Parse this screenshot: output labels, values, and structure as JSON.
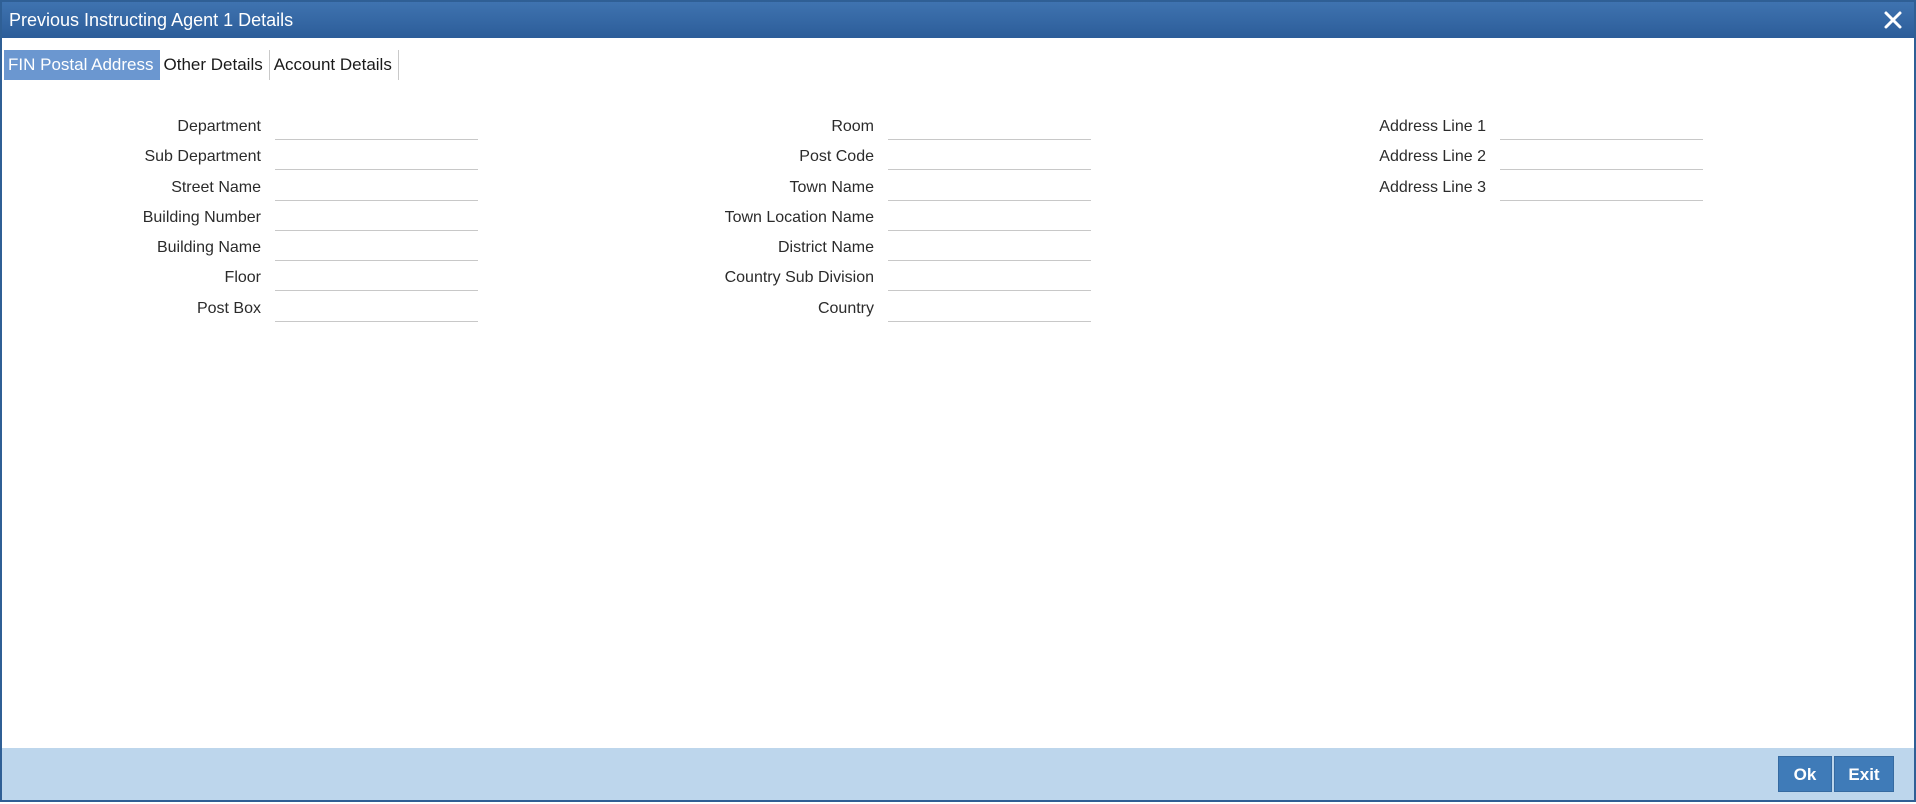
{
  "window": {
    "title": "Previous Instructing Agent 1 Details",
    "close_icon": "close-icon"
  },
  "tabs": [
    {
      "label": "FIN Postal Address",
      "active": true
    },
    {
      "label": "Other Details",
      "active": false
    },
    {
      "label": "Account Details",
      "active": false
    }
  ],
  "form": {
    "column1": [
      {
        "label": "Department",
        "value": ""
      },
      {
        "label": "Sub Department",
        "value": ""
      },
      {
        "label": "Street Name",
        "value": ""
      },
      {
        "label": "Building Number",
        "value": ""
      },
      {
        "label": "Building Name",
        "value": ""
      },
      {
        "label": "Floor",
        "value": ""
      },
      {
        "label": "Post Box",
        "value": ""
      }
    ],
    "column2": [
      {
        "label": "Room",
        "value": ""
      },
      {
        "label": "Post Code",
        "value": ""
      },
      {
        "label": "Town Name",
        "value": ""
      },
      {
        "label": "Town Location Name",
        "value": ""
      },
      {
        "label": "District Name",
        "value": ""
      },
      {
        "label": "Country Sub Division",
        "value": ""
      },
      {
        "label": "Country",
        "value": ""
      }
    ],
    "column3": [
      {
        "label": "Address Line 1",
        "value": ""
      },
      {
        "label": "Address Line 2",
        "value": ""
      },
      {
        "label": "Address Line 3",
        "value": ""
      }
    ]
  },
  "footer": {
    "ok_label": "Ok",
    "exit_label": "Exit"
  },
  "colors": {
    "titlebar": "#2c5d99",
    "active_tab": "#6b97d0",
    "footer": "#bdd6ec",
    "button": "#3f7bb8"
  }
}
